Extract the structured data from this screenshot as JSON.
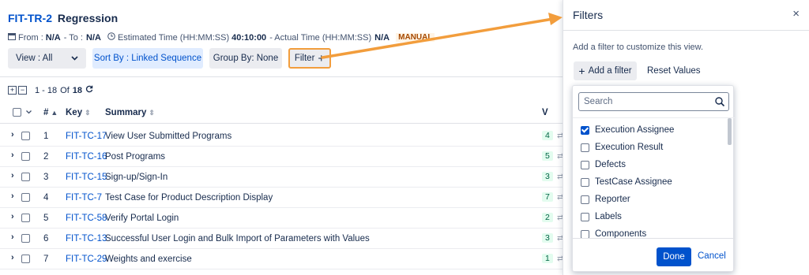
{
  "header": {
    "key": "FIT-TR-2",
    "name": "Regression",
    "from_label": "From :",
    "from_value": "N/A",
    "to_label": "- To :",
    "to_value": "N/A",
    "estimated_label": "Estimated Time (HH:MM:SS)",
    "estimated_value": "40:10:00",
    "actual_label": "- Actual Time (HH:MM:SS)",
    "actual_value": "N/A",
    "type_badge": "MANUAL"
  },
  "toolbar": {
    "view_label": "View : All",
    "sort_label": "Sort By : Linked Sequence",
    "group_label": "Group By: None",
    "filter_label": "Filter",
    "filter_plus": "+"
  },
  "pager": {
    "range": "1 - 18",
    "of": "Of",
    "total": "18"
  },
  "table": {
    "columns": {
      "num": "#",
      "key": "Key",
      "summary": "Summary",
      "v": "V"
    },
    "rows": [
      {
        "num": "1",
        "key": "FIT-TC-17",
        "summary": "View User Submitted Programs",
        "v": "4"
      },
      {
        "num": "2",
        "key": "FIT-TC-16",
        "summary": "Post Programs",
        "v": "5"
      },
      {
        "num": "3",
        "key": "FIT-TC-15",
        "summary": "Sign-up/Sign-In",
        "v": "3"
      },
      {
        "num": "4",
        "key": "FIT-TC-7",
        "summary": "Test Case for Product Description Display",
        "v": "7"
      },
      {
        "num": "5",
        "key": "FIT-TC-58",
        "summary": "Verify Portal Login",
        "v": "2"
      },
      {
        "num": "6",
        "key": "FIT-TC-13",
        "summary": "Successful User Login and Bulk Import of Parameters with Values",
        "v": "3"
      },
      {
        "num": "7",
        "key": "FIT-TC-29",
        "summary": "Weights and exercise",
        "v": "1"
      }
    ]
  },
  "drawer": {
    "title": "Filters",
    "close": "×",
    "hint": "Add a filter to customize this view.",
    "add_filter": "Add a filter",
    "add_plus": "+",
    "reset": "Reset Values"
  },
  "dropdown": {
    "search_placeholder": "Search",
    "options": [
      {
        "label": "Execution Assignee",
        "checked": true
      },
      {
        "label": "Execution Result",
        "checked": false
      },
      {
        "label": "Defects",
        "checked": false
      },
      {
        "label": "TestCase Assignee",
        "checked": false
      },
      {
        "label": "Reporter",
        "checked": false
      },
      {
        "label": "Labels",
        "checked": false
      },
      {
        "label": "Components",
        "checked": false
      }
    ],
    "done": "Done",
    "cancel": "Cancel"
  },
  "colors": {
    "accent": "#0052cc",
    "annotation_arrow": "#f29d3c",
    "manual_badge": "#a54800"
  }
}
